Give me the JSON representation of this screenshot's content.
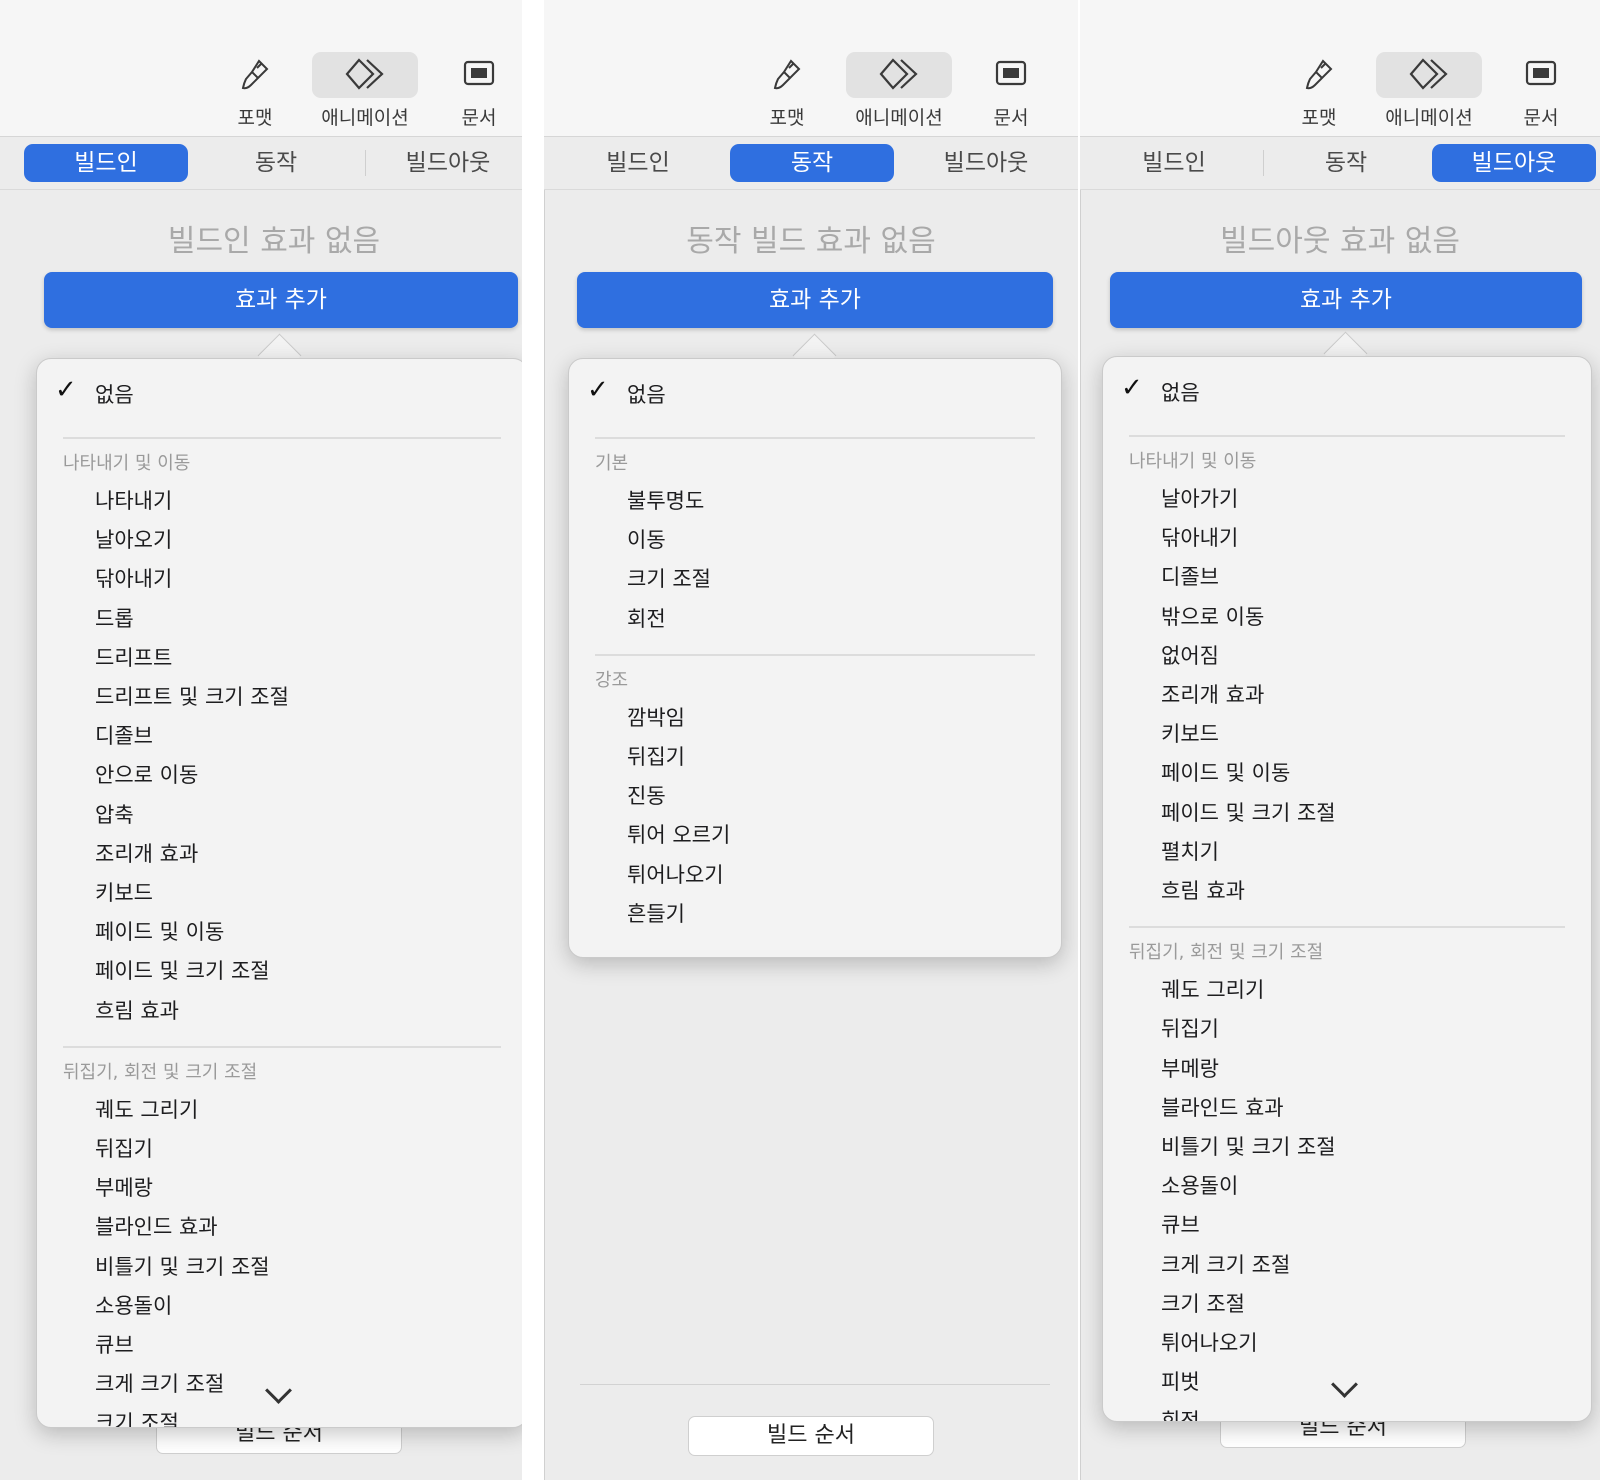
{
  "toolbar": {
    "format_label": "포맷",
    "animate_label": "애니메이션",
    "document_label": "문서",
    "format_icon": "paintbrush-icon",
    "animate_icon": "diamond-animate-icon",
    "document_icon": "document-icon"
  },
  "tabs": {
    "build_in": "빌드인",
    "action": "동작",
    "build_out": "빌드아웃"
  },
  "accent_color": "#2f6fe0",
  "panels": [
    {
      "active_tab": "빌드인",
      "no_effect": "빌드인 효과 없음",
      "add_effect": "효과 추가",
      "build_order": "빌드 순서",
      "none_label": "없음",
      "sections": [
        {
          "title": "나타내기 및 이동",
          "items": [
            "나타내기",
            "날아오기",
            "닦아내기",
            "드롭",
            "드리프트",
            "드리프트 및 크기 조절",
            "디졸브",
            "안으로 이동",
            "압축",
            "조리개 효과",
            "키보드",
            "페이드 및 이동",
            "페이드 및 크기 조절",
            "흐림 효과"
          ]
        },
        {
          "title": "뒤집기, 회전 및 크기 조절",
          "items": [
            "궤도 그리기",
            "뒤집기",
            "부메랑",
            "블라인드 효과",
            "비틀기 및 크기 조절",
            "소용돌이",
            "큐브",
            "크게 크기 조절",
            "크기 조절"
          ]
        }
      ]
    },
    {
      "active_tab": "동작",
      "no_effect": "동작 빌드 효과 없음",
      "add_effect": "효과 추가",
      "build_order": "빌드 순서",
      "none_label": "없음",
      "sections": [
        {
          "title": "기본",
          "items": [
            "불투명도",
            "이동",
            "크기 조절",
            "회전"
          ]
        },
        {
          "title": "강조",
          "items": [
            "깜박임",
            "뒤집기",
            "진동",
            "튀어 오르기",
            "튀어나오기",
            "흔들기"
          ]
        }
      ]
    },
    {
      "active_tab": "빌드아웃",
      "no_effect": "빌드아웃 효과 없음",
      "add_effect": "효과 추가",
      "build_order": "빌드 순서",
      "none_label": "없음",
      "sections": [
        {
          "title": "나타내기 및 이동",
          "items": [
            "날아가기",
            "닦아내기",
            "디졸브",
            "밖으로 이동",
            "없어짐",
            "조리개 효과",
            "키보드",
            "페이드 및 이동",
            "페이드 및 크기 조절",
            "펼치기",
            "흐림 효과"
          ]
        },
        {
          "title": "뒤집기, 회전 및 크기 조절",
          "items": [
            "궤도 그리기",
            "뒤집기",
            "부메랑",
            "블라인드 효과",
            "비틀기 및 크기 조절",
            "소용돌이",
            "큐브",
            "크게 크기 조절",
            "크기 조절",
            "튀어나오기",
            "피벗",
            "회전"
          ]
        }
      ]
    }
  ]
}
